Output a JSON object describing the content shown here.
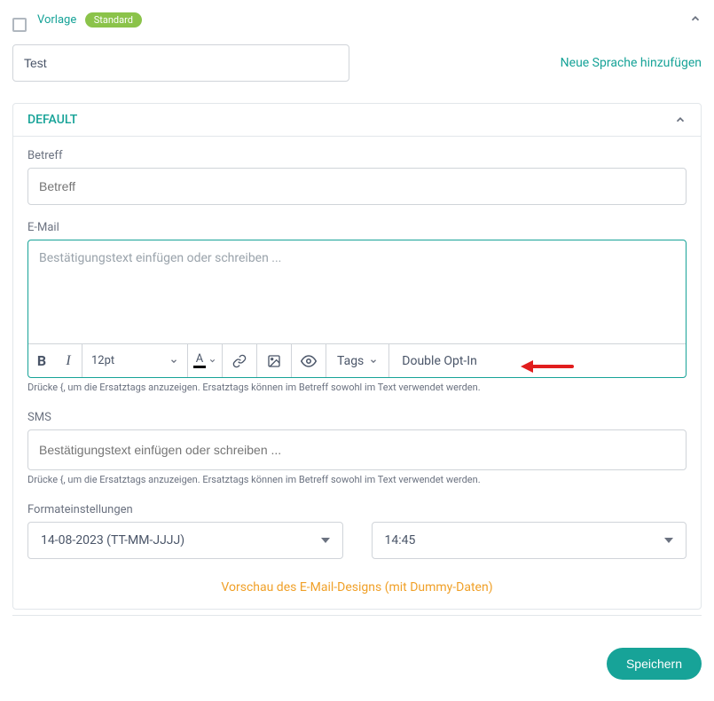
{
  "header": {
    "label": "Vorlage",
    "badge": "Standard"
  },
  "name_input": "Test",
  "add_language": "Neue Sprache hinzufügen",
  "panel": {
    "title": "DEFAULT",
    "subject_label": "Betreff",
    "subject_placeholder": "Betreff",
    "email_label": "E-Mail",
    "email_placeholder": "Bestätigungstext einfügen oder schreiben ...",
    "toolbar": {
      "font_size": "12pt",
      "tags": "Tags",
      "double_opt_in": "Double Opt-In"
    },
    "help_text": "Drücke {, um die Ersatztags anzuzeigen. Ersatztags können im Betreff sowohl im Text verwendet werden.",
    "sms_label": "SMS",
    "sms_placeholder": "Bestätigungstext einfügen oder schreiben ...",
    "format_label": "Formateinstellungen",
    "date_value": "14-08-2023 (TT-MM-JJJJ)",
    "time_value": "14:45",
    "preview_link": "Vorschau des E-Mail-Designs (mit Dummy-Daten)"
  },
  "save_button": "Speichern"
}
